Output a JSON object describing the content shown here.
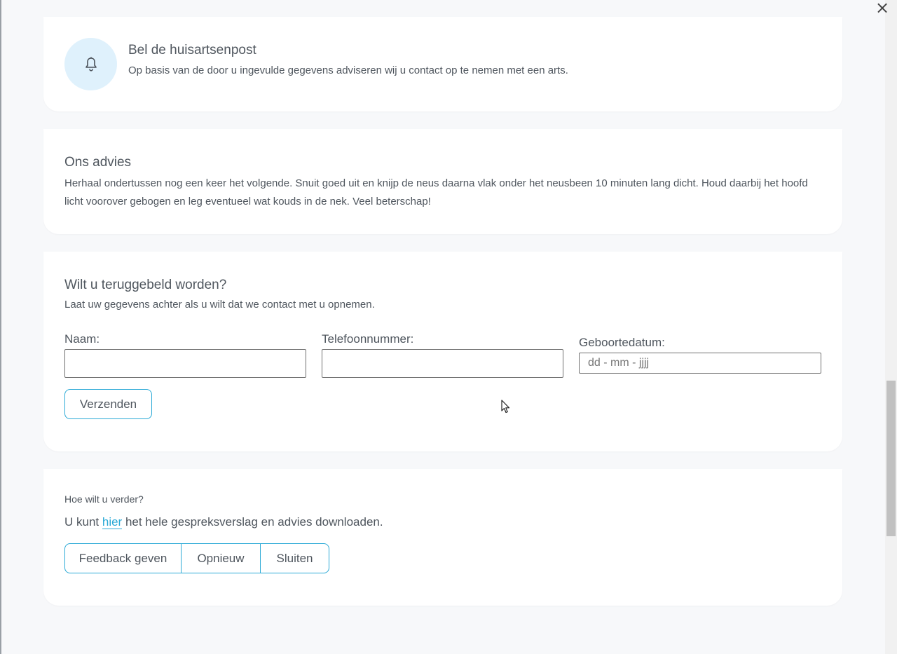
{
  "window": {
    "close_label": "×"
  },
  "advice_call": {
    "title": "Bel de huisartsenpost",
    "text": "Op basis van de door u ingevulde gegevens adviseren wij u contact op te nemen met een arts.",
    "icon": "bell-icon"
  },
  "advice": {
    "title": "Ons advies",
    "text": "Herhaal ondertussen nog een keer het volgende. Snuit goed uit en knijp de neus daarna vlak onder het neusbeen 10 minuten lang dicht. Houd daarbij het hoofd licht voorover gebogen en leg eventueel wat kouds in de nek. Veel beterschap!"
  },
  "callback": {
    "title": "Wilt u teruggebeld worden?",
    "subtitle": "Laat uw gegevens achter als u wilt dat we contact met u opnemen.",
    "name_label": "Naam:",
    "name_value": "",
    "phone_label": "Telefoonnummer:",
    "phone_value": "",
    "dob_label": "Geboortedatum:",
    "dob_placeholder": "dd - mm - jjjj",
    "submit_label": "Verzenden"
  },
  "next": {
    "question": "Hoe wilt u verder?",
    "text_before": "U kunt ",
    "link_label": "hier",
    "text_after": " het hele gespreksverslag en advies downloaden.",
    "buttons": [
      "Feedback geven",
      "Opnieuw",
      "Sluiten"
    ]
  },
  "colors": {
    "accent": "#2aa9d6",
    "icon_bg": "#dff1fc",
    "page_bg": "#f7f8fa"
  }
}
